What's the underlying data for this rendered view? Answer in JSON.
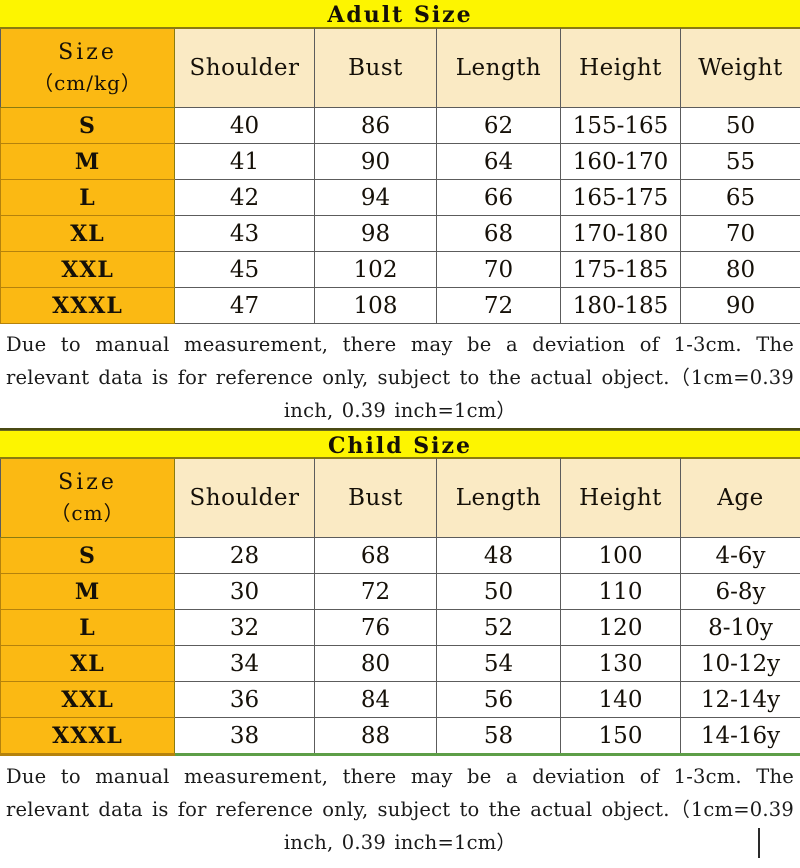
{
  "adult": {
    "banner_title": "Adult Size",
    "size_header_line1": "Size",
    "size_header_line2": "（cm/kg）",
    "columns": [
      "Shoulder",
      "Bust",
      "Length",
      "Height",
      "Weight"
    ],
    "rows": [
      {
        "size": "S",
        "shoulder": "40",
        "bust": "86",
        "length": "62",
        "height": "155-165",
        "weight": "50"
      },
      {
        "size": "M",
        "shoulder": "41",
        "bust": "90",
        "length": "64",
        "height": "160-170",
        "weight": "55"
      },
      {
        "size": "L",
        "shoulder": "42",
        "bust": "94",
        "length": "66",
        "height": "165-175",
        "weight": "65"
      },
      {
        "size": "XL",
        "shoulder": "43",
        "bust": "98",
        "length": "68",
        "height": "170-180",
        "weight": "70"
      },
      {
        "size": "XXL",
        "shoulder": "45",
        "bust": "102",
        "length": "70",
        "height": "175-185",
        "weight": "80"
      },
      {
        "size": "XXXL",
        "shoulder": "47",
        "bust": "108",
        "length": "72",
        "height": "180-185",
        "weight": "90"
      }
    ],
    "note": "Due to manual measurement, there may be a deviation of 1-3cm. The relevant data is for reference only, subject to the actual object.（1cm=0.39 inch, 0.39 inch=1cm）"
  },
  "child": {
    "banner_title": "Child Size",
    "size_header_line1": "Size",
    "size_header_line2": "（cm）",
    "columns": [
      "Shoulder",
      "Bust",
      "Length",
      "Height",
      "Age"
    ],
    "rows": [
      {
        "size": "S",
        "shoulder": "28",
        "bust": "68",
        "length": "48",
        "height": "100",
        "age": "4-6y"
      },
      {
        "size": "M",
        "shoulder": "30",
        "bust": "72",
        "length": "50",
        "height": "110",
        "age": "6-8y"
      },
      {
        "size": "L",
        "shoulder": "32",
        "bust": "76",
        "length": "52",
        "height": "120",
        "age": "8-10y"
      },
      {
        "size": "XL",
        "shoulder": "34",
        "bust": "80",
        "length": "54",
        "height": "130",
        "age": "10-12y"
      },
      {
        "size": "XXL",
        "shoulder": "36",
        "bust": "84",
        "length": "56",
        "height": "140",
        "age": "12-14y"
      },
      {
        "size": "XXXL",
        "shoulder": "38",
        "bust": "88",
        "length": "58",
        "height": "150",
        "age": "14-16y"
      }
    ],
    "note": "Due to manual measurement, there may be a deviation of 1-3cm. The relevant data is for reference only, subject to the actual object.（1cm=0.39 inch, 0.39 inch=1cm）"
  },
  "colors": {
    "banner_yellow": "#fdf500",
    "size_column_orange": "#fbb913",
    "header_cream": "#faeac4",
    "grid_gray": "#5c5c5c",
    "child_bottom_green": "#5d9e47",
    "text_black": "#151008"
  }
}
